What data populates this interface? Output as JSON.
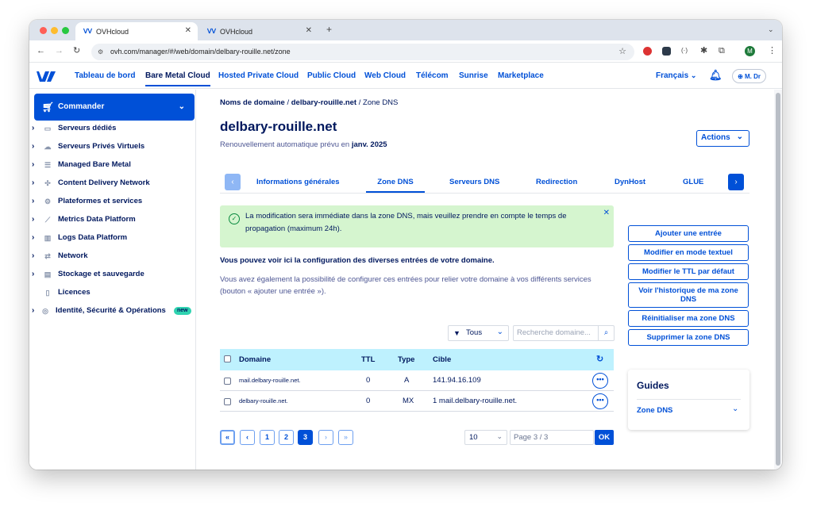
{
  "browser": {
    "tabs": [
      {
        "title": "OVHcloud",
        "active": true
      },
      {
        "title": "OVHcloud",
        "active": false
      }
    ],
    "url": "ovh.com/manager/#/web/domain/delbary-rouille.net/zone",
    "profile_initial": "M"
  },
  "header": {
    "nav": [
      "Tableau de bord",
      "Bare Metal Cloud",
      "Hosted Private Cloud",
      "Public Cloud",
      "Web Cloud",
      "Télécom",
      "Sunrise",
      "Marketplace"
    ],
    "active_nav": "Bare Metal Cloud",
    "language": "Français",
    "user": "M. Dr"
  },
  "sidebar": {
    "commander": "Commander",
    "items": [
      {
        "label": "Serveurs dédiés",
        "icon": "server-icon",
        "chevron": true
      },
      {
        "label": "Serveurs Privés Virtuels",
        "icon": "cloud-icon",
        "chevron": true
      },
      {
        "label": "Managed Bare Metal",
        "icon": "rack-icon",
        "chevron": true
      },
      {
        "label": "Content Delivery Network",
        "icon": "network-icon",
        "chevron": true
      },
      {
        "label": "Plateformes et services",
        "icon": "gear-icon",
        "chevron": true
      },
      {
        "label": "Metrics Data Platform",
        "icon": "line-chart-icon",
        "chevron": true
      },
      {
        "label": "Logs Data Platform",
        "icon": "bar-chart-icon",
        "chevron": true
      },
      {
        "label": "Network",
        "icon": "arrows-icon",
        "chevron": true
      },
      {
        "label": "Stockage et sauvegarde",
        "icon": "storage-icon",
        "chevron": true
      },
      {
        "label": "Licences",
        "icon": "license-icon",
        "chevron": false
      },
      {
        "label": "Identité, Sécurité & Opérations",
        "icon": "shield-icon",
        "chevron": true,
        "badge": "new"
      }
    ]
  },
  "main": {
    "breadcrumb": {
      "part1": "Noms de domaine",
      "sep": "/",
      "part2": "delbary-rouille.net",
      "part3": "Zone DNS"
    },
    "title": "delbary-rouille.net",
    "renewal_text": "Renouvellement automatique prévu en",
    "renewal_date": "janv. 2025",
    "actions": "Actions",
    "tabs": [
      "Informations générales",
      "Zone DNS",
      "Serveurs DNS",
      "Redirection",
      "DynHost",
      "GLUE"
    ],
    "active_tab": "Zone DNS",
    "alert": "La modification sera immédiate dans la zone DNS, mais veuillez prendre en compte le temps de propagation (maximum 24h).",
    "info_bold": "Vous pouvez voir ici la configuration des diverses entrées de votre domaine.",
    "info_text": "Vous avez également la possibilité de configurer ces entrées pour relier votre domaine à vos différents services (bouton « ajouter une entrée »).",
    "side_buttons": [
      "Ajouter une entrée",
      "Modifier en mode textuel",
      "Modifier le TTL par défaut",
      "Voir l'historique de ma zone DNS",
      "Réinitialiser ma zone DNS",
      "Supprimer la zone DNS"
    ],
    "filter": {
      "value": "Tous",
      "search_placeholder": "Recherche domaine..."
    },
    "table": {
      "headers": {
        "domain": "Domaine",
        "ttl": "TTL",
        "type": "Type",
        "target": "Cible"
      },
      "rows": [
        {
          "domain": "mail.delbary-rouille.net.",
          "ttl": "0",
          "type": "A",
          "target": "141.94.16.109"
        },
        {
          "domain": "delbary-rouille.net.",
          "ttl": "0",
          "type": "MX",
          "target": "1 mail.delbary-rouille.net."
        }
      ]
    },
    "pagination": {
      "pages": [
        "1",
        "2",
        "3"
      ],
      "current": "3",
      "per_page": "10",
      "page_label": "Page 3 / 3",
      "ok": "OK"
    },
    "guides": {
      "title": "Guides",
      "item": "Zone DNS"
    }
  },
  "colors": {
    "primary": "#0050d7",
    "navy": "#00185e",
    "alert_bg": "#d5f5cf",
    "table_header": "#bef1fe"
  }
}
